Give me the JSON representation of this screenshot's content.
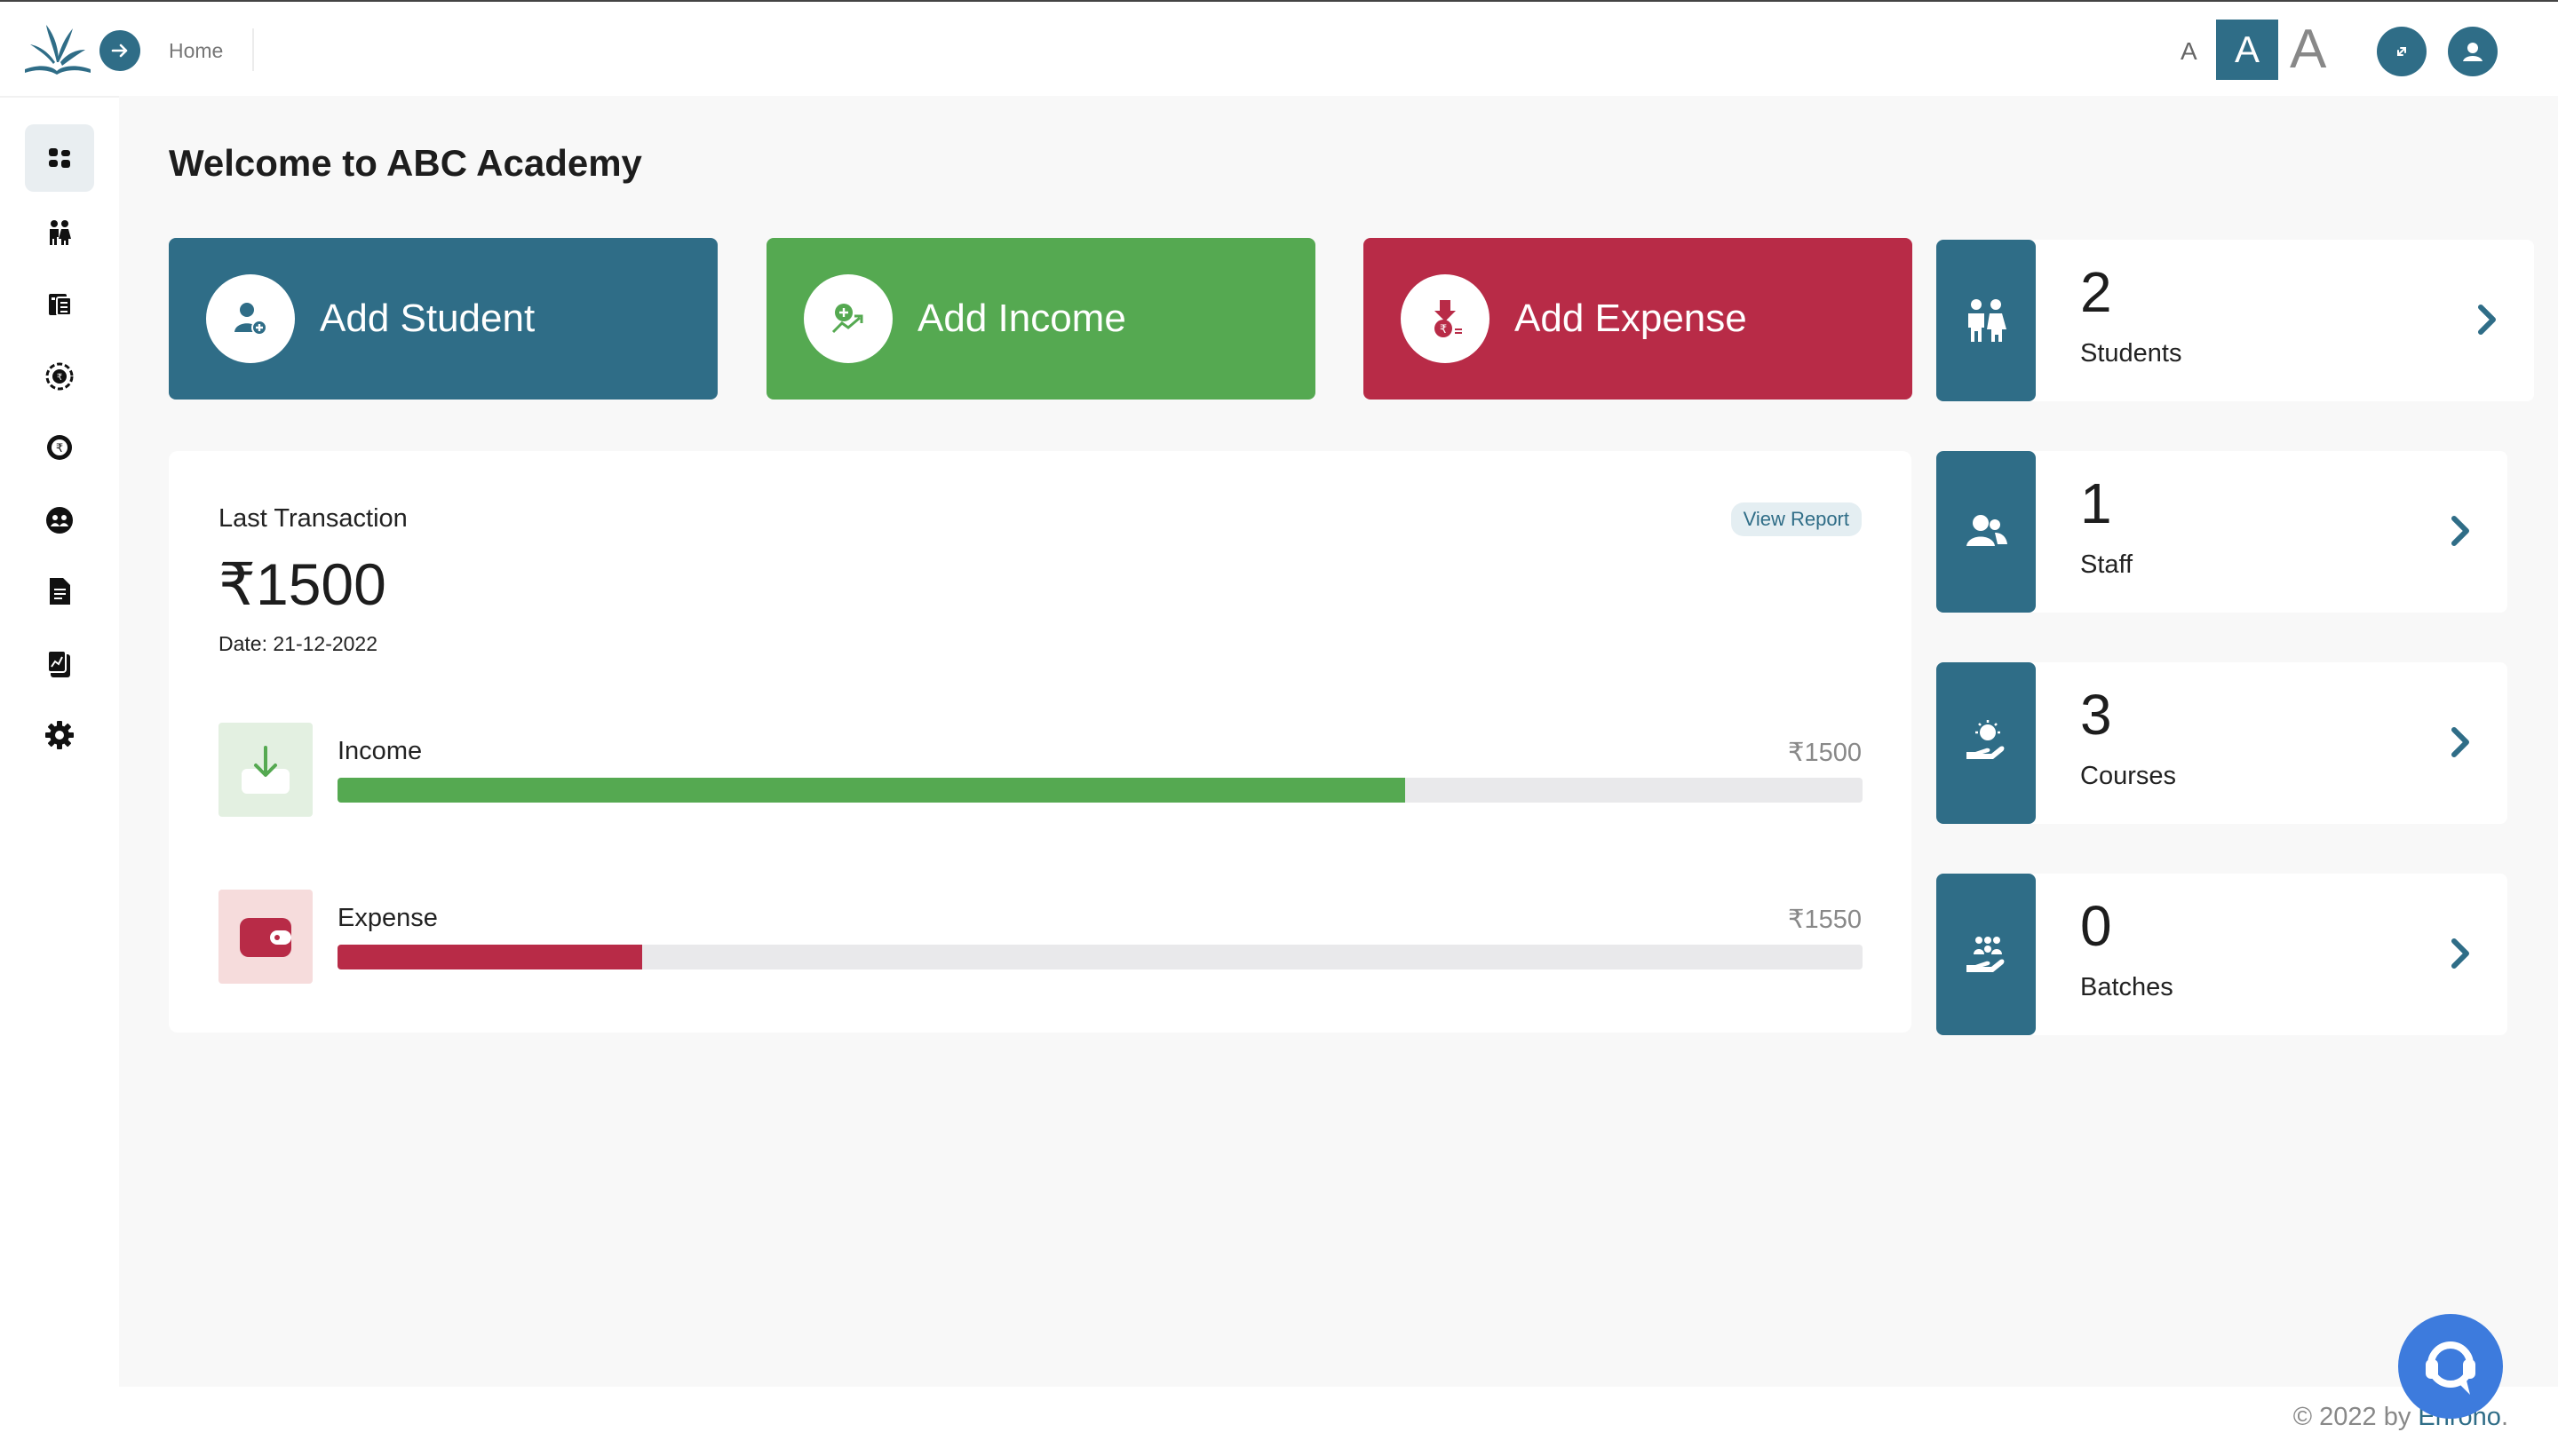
{
  "topbar": {
    "breadcrumb": "Home",
    "font_small": "A",
    "font_medium": "A",
    "font_large": "A"
  },
  "sidebar": {
    "items": [
      {
        "id": "dashboard",
        "icon": "dashboard-icon",
        "active": true
      },
      {
        "id": "students",
        "icon": "students-icon"
      },
      {
        "id": "courses",
        "icon": "courses-icon"
      },
      {
        "id": "income",
        "icon": "income-icon"
      },
      {
        "id": "expense",
        "icon": "expense-icon"
      },
      {
        "id": "staff",
        "icon": "staff-icon"
      },
      {
        "id": "documents",
        "icon": "document-icon"
      },
      {
        "id": "reports",
        "icon": "report-icon"
      },
      {
        "id": "settings",
        "icon": "gear-icon"
      }
    ]
  },
  "page": {
    "title": "Welcome to ABC Academy"
  },
  "actions": {
    "add_student": "Add Student",
    "add_income": "Add Income",
    "add_expense": "Add Expense"
  },
  "stats": {
    "students": {
      "count": "2",
      "label": "Students"
    },
    "staff": {
      "count": "1",
      "label": "Staff"
    },
    "courses": {
      "count": "3",
      "label": "Courses"
    },
    "batches": {
      "count": "0",
      "label": "Batches"
    }
  },
  "transaction": {
    "label": "Last Transaction",
    "amount": "₹1500",
    "date": "Date: 21-12-2022",
    "view_report": "View Report",
    "income": {
      "label": "Income",
      "value": "₹1500",
      "progress": 0.7
    },
    "expense": {
      "label": "Expense",
      "value": "₹1550",
      "progress": 0.2
    }
  },
  "footer": {
    "prefix": "© 2022 by ",
    "brand": "Enrono",
    "suffix": "."
  },
  "colors": {
    "primary": "#2f6d87",
    "income": "#55a951",
    "expense": "#b82b47"
  }
}
